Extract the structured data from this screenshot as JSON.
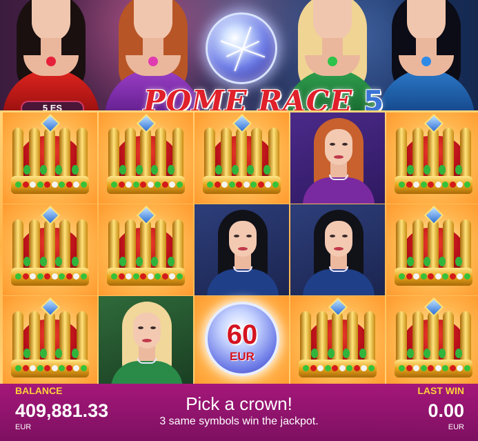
{
  "game": {
    "logo_text": "POME RACE",
    "logo_number": "5",
    "lines_badge": "5 ES"
  },
  "grid": {
    "rows": 3,
    "cols": 5,
    "cells": [
      {
        "type": "crown"
      },
      {
        "type": "crown"
      },
      {
        "type": "crown"
      },
      {
        "type": "portrait",
        "hair": "#c8612e",
        "dress": "#7a2aa0",
        "bg": "bgpurple"
      },
      {
        "type": "crown"
      },
      {
        "type": "crown"
      },
      {
        "type": "crown"
      },
      {
        "type": "portrait",
        "hair": "#111118",
        "dress": "#1f3f88",
        "bg": "bgblue"
      },
      {
        "type": "portrait",
        "hair": "#111118",
        "dress": "#1f3f88",
        "bg": "bgblue"
      },
      {
        "type": "crown"
      },
      {
        "type": "crown"
      },
      {
        "type": "portrait",
        "hair": "#f1d79a",
        "dress": "#2a8a48",
        "bg": "bggreen"
      },
      {
        "type": "prize",
        "amount": "60",
        "currency": "EUR"
      },
      {
        "type": "crown"
      },
      {
        "type": "crown"
      }
    ]
  },
  "bottom": {
    "balance_label": "BALANCE",
    "balance_value": "409,881.33",
    "balance_currency": "EUR",
    "message_title": "Pick a crown!",
    "message_sub": "3 same symbols win the jackpot.",
    "last_win_label": "LAST WIN",
    "last_win_value": "0.00",
    "last_win_currency": "EUR"
  },
  "colors": {
    "accent_yellow": "#ffd23c",
    "bar_magenta": "#a5177a",
    "logo_red": "#e0202a",
    "logo_blue": "#3b74d6"
  }
}
